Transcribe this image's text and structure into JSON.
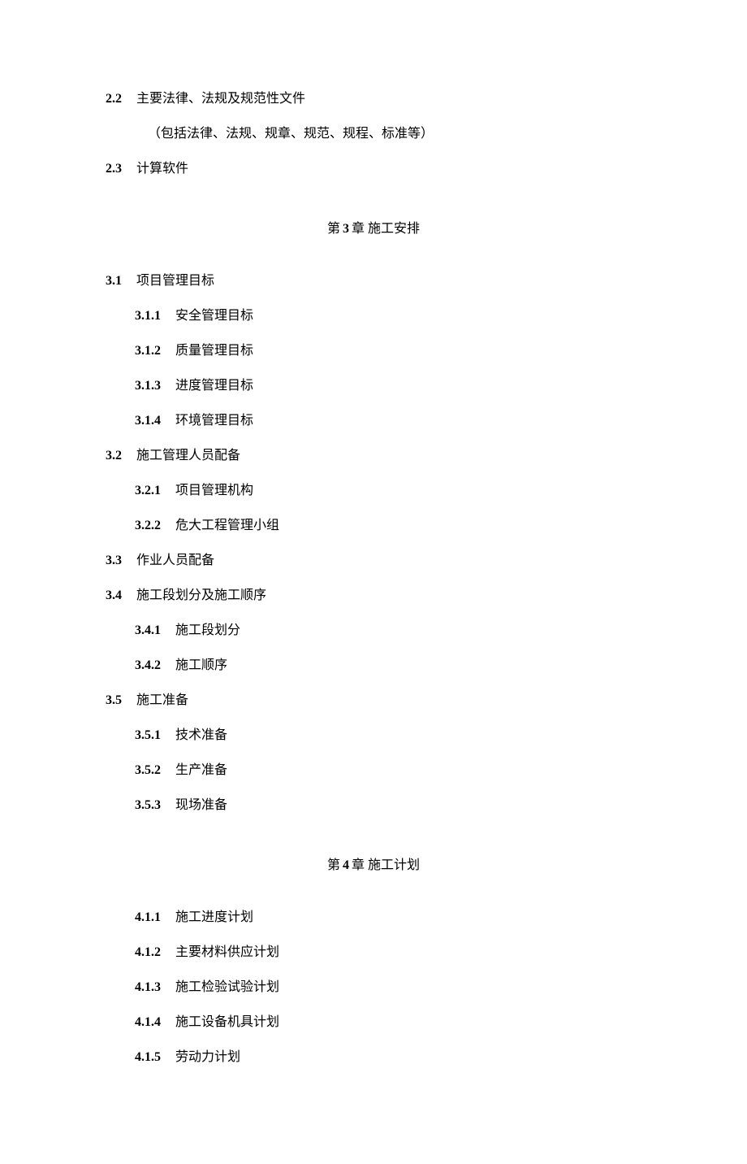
{
  "s22": {
    "num": "2.2",
    "title": "主要法律、法规及规范性文件",
    "note": "（包括法律、法规、规章、规范、规程、标准等）"
  },
  "s23": {
    "num": "2.3",
    "title": "计算软件"
  },
  "ch3": {
    "prefix": "第",
    "num": "3",
    "suffix": "章 施工安排"
  },
  "s31": {
    "num": "3.1",
    "title": "项目管理目标",
    "items": [
      {
        "num": "3.1.1",
        "title": "安全管理目标"
      },
      {
        "num": "3.1.2",
        "title": "质量管理目标"
      },
      {
        "num": "3.1.3",
        "title": "进度管理目标"
      },
      {
        "num": "3.1.4",
        "title": "环境管理目标"
      }
    ]
  },
  "s32": {
    "num": "3.2",
    "title": "施工管理人员配备",
    "items": [
      {
        "num": "3.2.1",
        "title": "项目管理机构"
      },
      {
        "num": "3.2.2",
        "title": "危大工程管理小组"
      }
    ]
  },
  "s33": {
    "num": "3.3",
    "title": "作业人员配备"
  },
  "s34": {
    "num": "3.4",
    "title": "施工段划分及施工顺序",
    "items": [
      {
        "num": "3.4.1",
        "title": "施工段划分"
      },
      {
        "num": "3.4.2",
        "title": "施工顺序"
      }
    ]
  },
  "s35": {
    "num": "3.5",
    "title": "施工准备",
    "items": [
      {
        "num": "3.5.1",
        "title": "技术准备"
      },
      {
        "num": "3.5.2",
        "title": "生产准备"
      },
      {
        "num": "3.5.3",
        "title": "现场准备"
      }
    ]
  },
  "ch4": {
    "prefix": "第",
    "num": "4",
    "suffix": "章 施工计划"
  },
  "s4items": [
    {
      "num": "4.1.1",
      "title": "施工进度计划"
    },
    {
      "num": "4.1.2",
      "title": "主要材料供应计划"
    },
    {
      "num": "4.1.3",
      "title": "施工检验试验计划"
    },
    {
      "num": "4.1.4",
      "title": "施工设备机具计划"
    },
    {
      "num": "4.1.5",
      "title": "劳动力计划"
    }
  ]
}
